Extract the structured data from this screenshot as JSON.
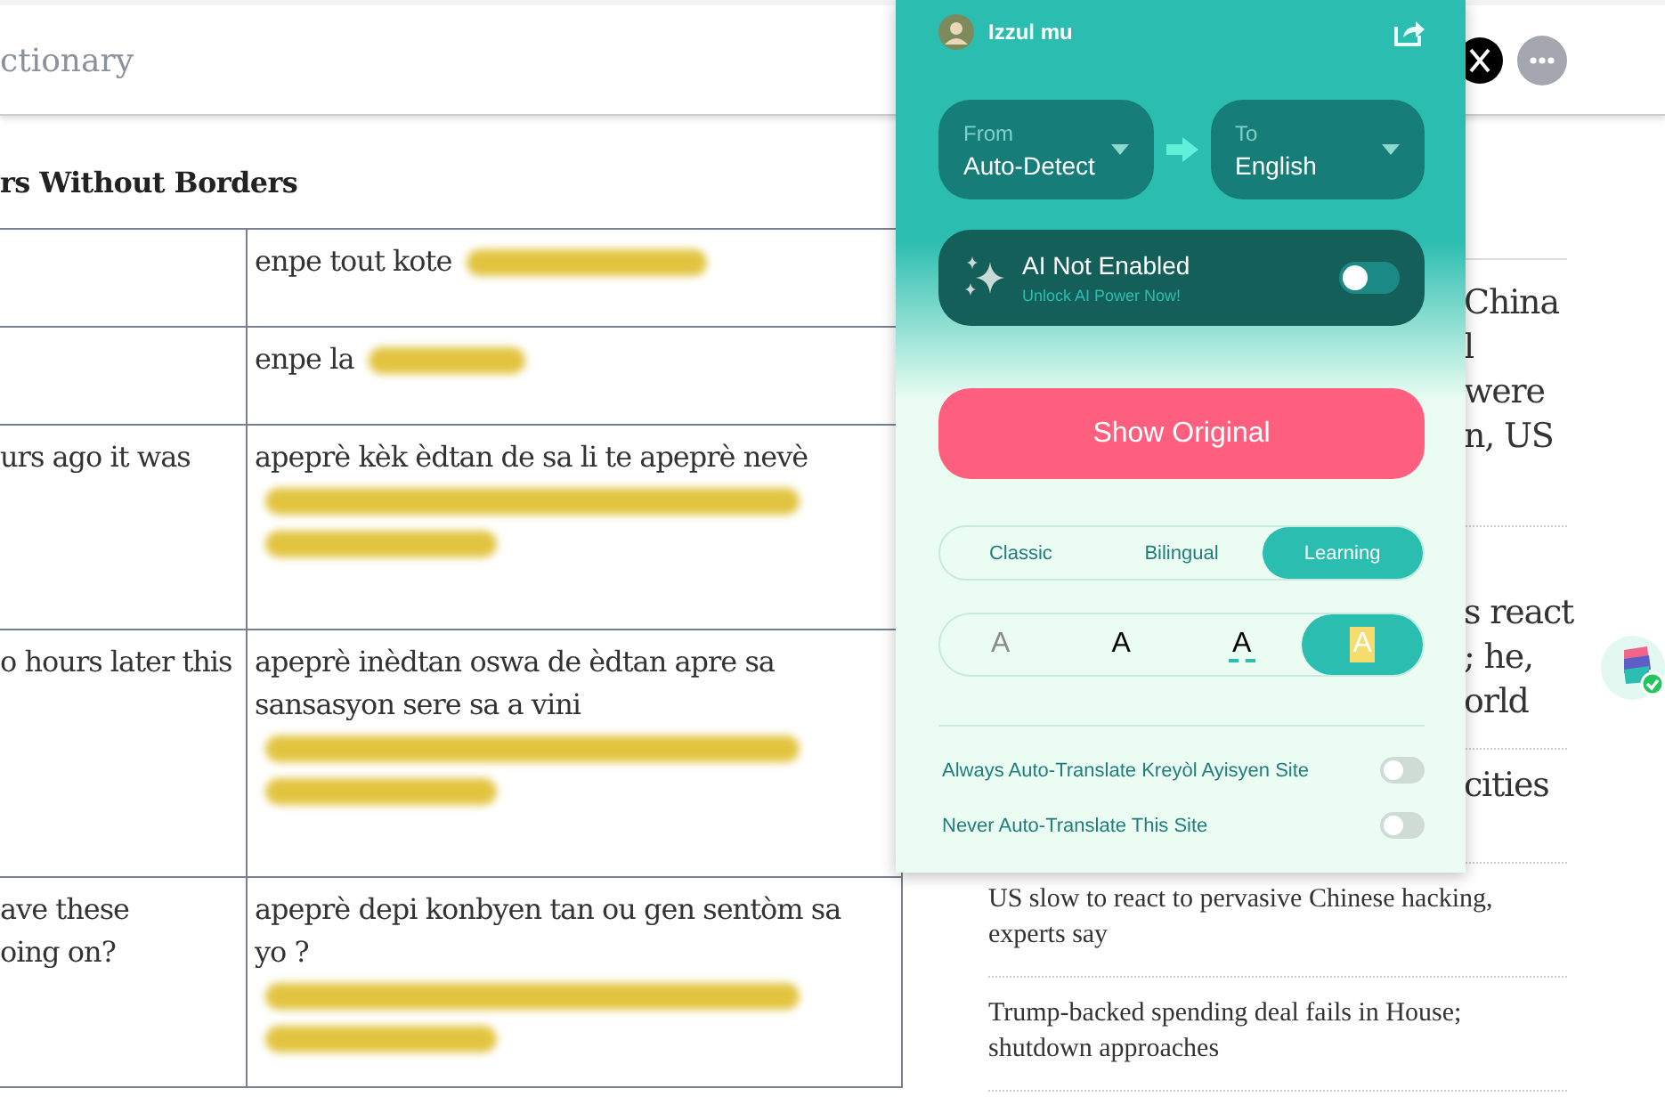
{
  "header": {
    "site_title": "ctionary"
  },
  "article": {
    "title": "rs Without Borders",
    "rows": [
      {
        "source": "",
        "target": {
          "text": "enpe tout kote",
          "blur": [
            {
              "kind": "inline-long"
            }
          ]
        }
      },
      {
        "source": "",
        "target": {
          "text": "enpe la",
          "blur": [
            {
              "kind": "inline-short"
            }
          ]
        }
      },
      {
        "source": "urs ago it was",
        "target": {
          "text": "apeprè kèk èdtan de sa li te apeprè nevè",
          "blur": [
            {
              "kind": "line-long"
            },
            {
              "kind": "line-short"
            }
          ]
        }
      },
      {
        "source": "o hours later this",
        "target": {
          "text": "apeprè inèdtan oswa de èdtan apre sa sansasyon sere sa a vini",
          "blur": [
            {
              "kind": "line-long"
            },
            {
              "kind": "line-short"
            }
          ]
        }
      },
      {
        "source": "ave these\noing on?",
        "target": {
          "text": "apeprè depi konbyen tan ou gen sentòm sa yo ?",
          "blur": [
            {
              "kind": "line-long"
            },
            {
              "kind": "line-short"
            }
          ]
        }
      }
    ]
  },
  "sidebar": {
    "items": [
      {
        "kind": "partial",
        "lines": [
          "China",
          "l",
          "were",
          "n, US"
        ]
      },
      {
        "kind": "partial",
        "lines": [
          "s react",
          "; he,",
          "orld"
        ]
      },
      {
        "kind": "partial",
        "lines": [
          "cities"
        ]
      },
      {
        "kind": "full",
        "lines": [
          "US slow to react to pervasive Chinese hacking, experts say"
        ]
      },
      {
        "kind": "full",
        "lines": [
          "Trump-backed spending deal fails in House; shutdown approaches"
        ]
      }
    ]
  },
  "popup": {
    "user": "Izzul mu",
    "from": {
      "label": "From",
      "value": "Auto-Detect"
    },
    "to": {
      "label": "To",
      "value": "English"
    },
    "ai": {
      "title": "AI Not Enabled",
      "subtitle": "Unlock AI Power Now!",
      "on": false
    },
    "show_original": "Show Original",
    "modes": [
      {
        "label": "Classic",
        "selected": false
      },
      {
        "label": "Bilingual",
        "selected": false
      },
      {
        "label": "Learning",
        "selected": true
      }
    ],
    "styles": [
      {
        "label": "A",
        "kind": "faded",
        "selected": false
      },
      {
        "label": "A",
        "kind": "plain",
        "selected": false
      },
      {
        "label": "A",
        "kind": "underline",
        "selected": false
      },
      {
        "label": "A",
        "kind": "highlight",
        "selected": true
      }
    ],
    "settings": [
      {
        "label": "Always Auto-Translate Kreyòl Ayisyen Site",
        "on": false
      },
      {
        "label": "Never Auto-Translate This Site",
        "on": false
      }
    ]
  }
}
